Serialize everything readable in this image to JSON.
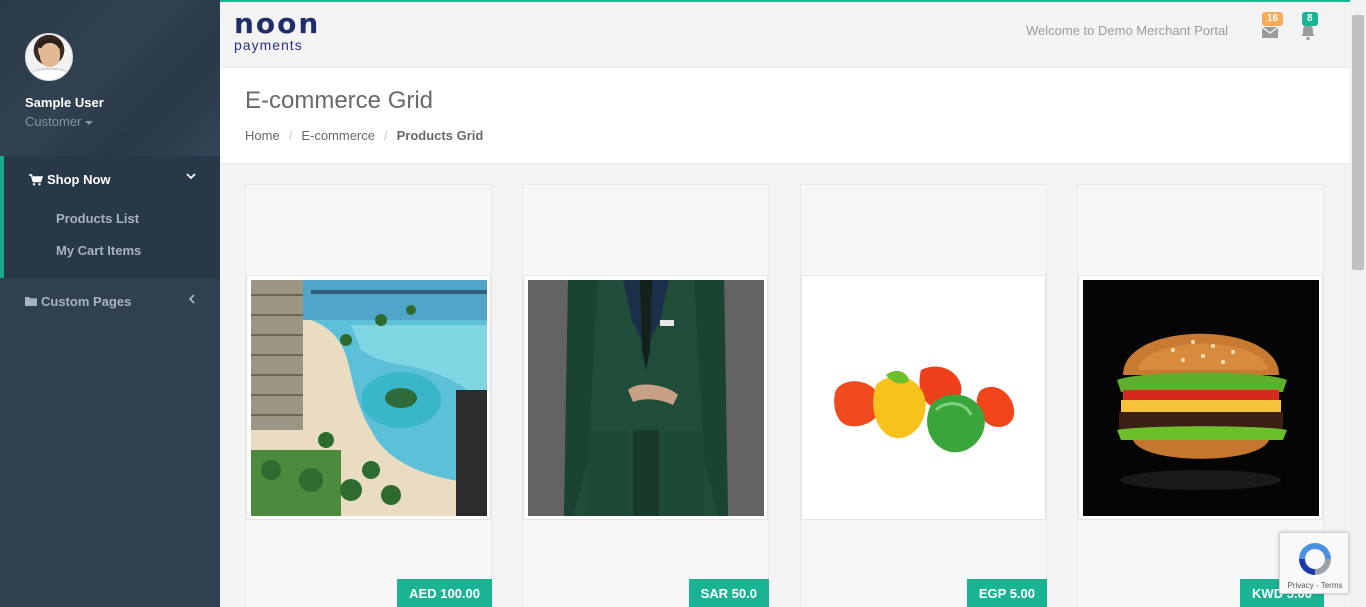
{
  "sidebar": {
    "user_name": "Sample User",
    "user_role": "Customer",
    "menu": [
      {
        "label": "Shop Now",
        "icon": "shopping-cart-icon",
        "expanded": true,
        "children": [
          {
            "label": "Products List"
          },
          {
            "label": "My Cart Items"
          }
        ]
      },
      {
        "label": "Custom Pages",
        "icon": "folder-icon",
        "expanded": false
      }
    ]
  },
  "topbar": {
    "logo_line1": "noon",
    "logo_line2": "payments",
    "welcome": "Welcome to Demo Merchant Portal",
    "messages_count": "16",
    "notifications_count": "8"
  },
  "page": {
    "title": "E-commerce Grid",
    "breadcrumb": [
      "Home",
      "E-commerce",
      "Products Grid"
    ]
  },
  "products": [
    {
      "image": "beach-resort-photo",
      "price": "AED 100.00"
    },
    {
      "image": "green-suit-photo",
      "price": "SAR 50.0"
    },
    {
      "image": "gummy-candies-photo",
      "price": "EGP 5.00"
    },
    {
      "image": "burger-photo",
      "price": "KWD 5.00"
    }
  ],
  "recaptcha": {
    "text": "Privacy - Terms"
  },
  "colors": {
    "accent": "#1ab394",
    "sidebar": "#2f4050",
    "badge_orange": "#f8ac59",
    "logo": "#1f2e6a"
  }
}
